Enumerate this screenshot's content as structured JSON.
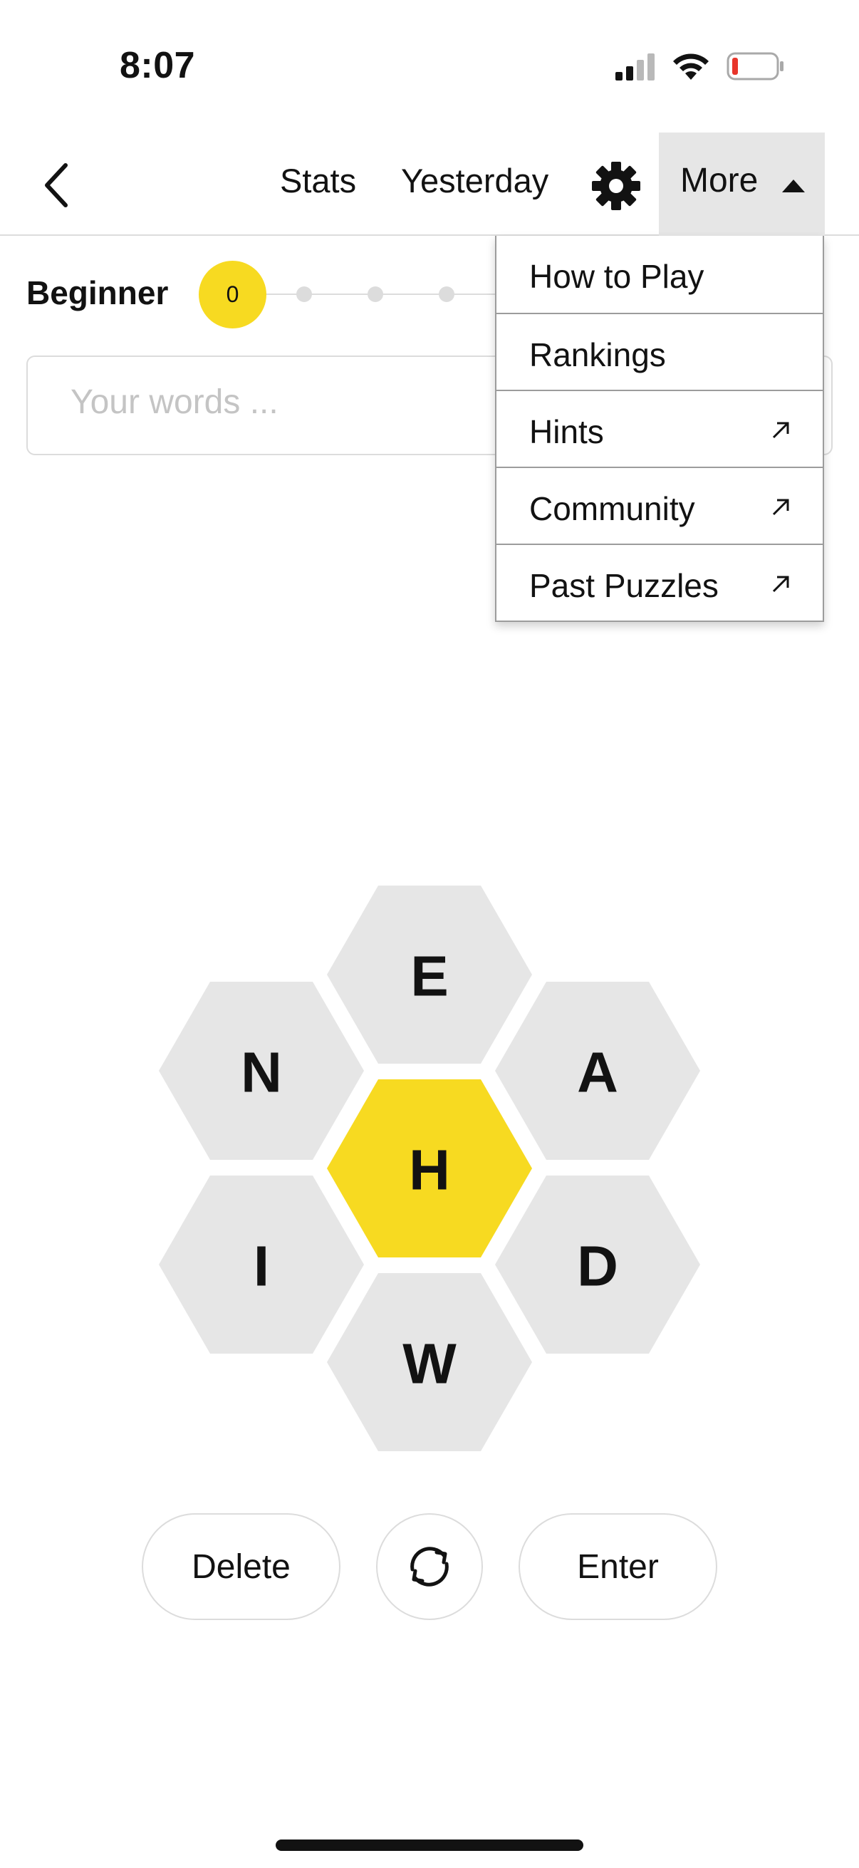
{
  "status_bar": {
    "time": "8:07",
    "icons": [
      "cellular-signal-icon",
      "wifi-icon",
      "battery-low-icon"
    ],
    "battery_color": "#e8352b"
  },
  "nav": {
    "back_icon": "chevron-left-icon",
    "stats_label": "Stats",
    "yesterday_label": "Yesterday",
    "settings_icon": "gear-icon",
    "more_label": "More",
    "more_icon": "caret-up-icon"
  },
  "progress": {
    "rank": "Beginner",
    "score": "0"
  },
  "word_list": {
    "placeholder": "Your words ..."
  },
  "more_menu": {
    "items": [
      {
        "label": "How to Play",
        "external": false
      },
      {
        "label": "Rankings",
        "external": false
      },
      {
        "label": "Hints",
        "external": true
      },
      {
        "label": "Community",
        "external": true
      },
      {
        "label": "Past Puzzles",
        "external": true
      }
    ]
  },
  "hive": {
    "center_letter": "H",
    "outer_letters": {
      "top": "E",
      "upper_left": "N",
      "upper_right": "A",
      "lower_left": "I",
      "lower_right": "D",
      "bottom": "W"
    },
    "center_color": "#f7da21",
    "outer_color": "#e6e6e6"
  },
  "controls": {
    "delete_label": "Delete",
    "shuffle_icon": "shuffle-icon",
    "enter_label": "Enter"
  },
  "colors": {
    "accent_yellow": "#f7da21",
    "menu_active_bg": "#e6e6e6",
    "text": "#121212"
  }
}
